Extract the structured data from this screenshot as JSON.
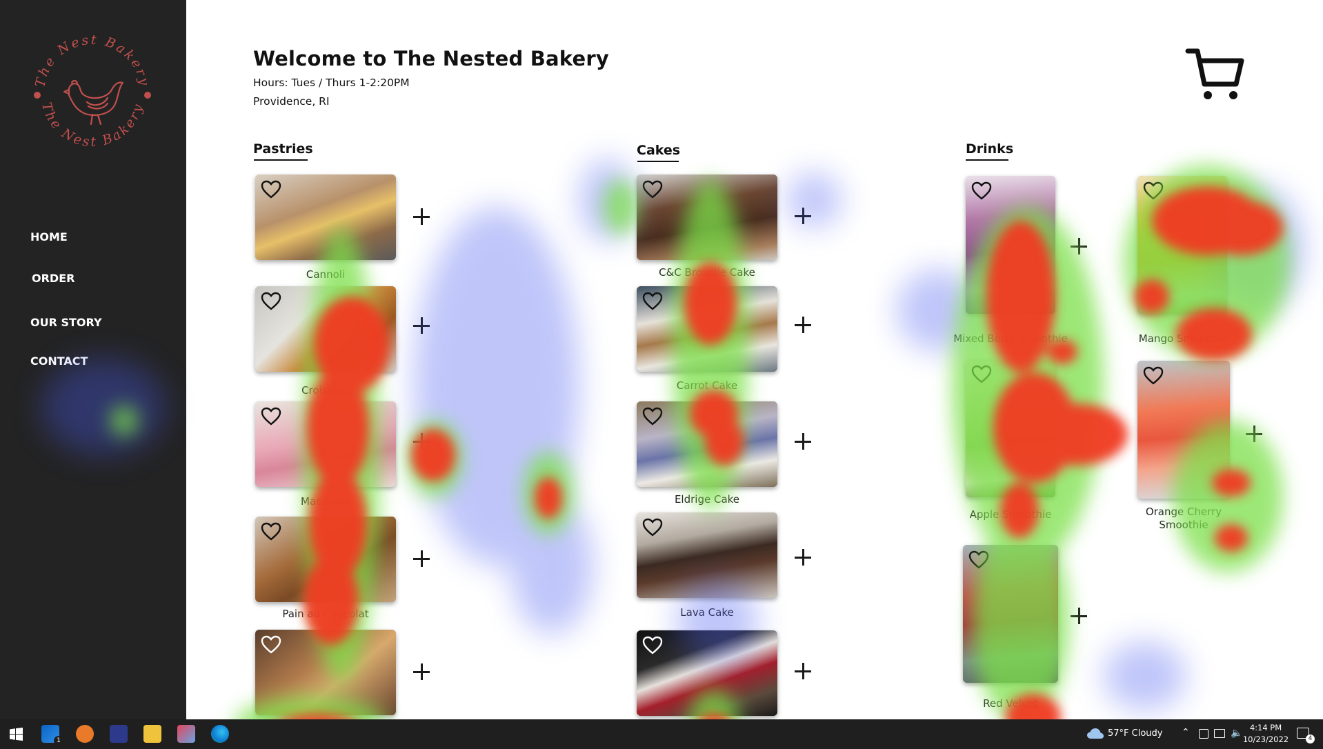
{
  "logo": {
    "text_top": "The Nest Bakery",
    "text_bottom": "The Nest Bakery",
    "color": "#c0504d"
  },
  "nav": [
    {
      "label": "HOME"
    },
    {
      "label": "ORDER"
    },
    {
      "label": "OUR STORY"
    },
    {
      "label": "CONTACT"
    }
  ],
  "header": {
    "title": "Welcome to The Nested Bakery",
    "hours": "Hours: Tues / Thurs 1-2:20PM",
    "location": "Providence, RI"
  },
  "icons": {
    "cart": "cart-icon",
    "favorite": "heart-icon",
    "add": "plus-icon"
  },
  "sections": [
    {
      "title": "Pastries",
      "items": [
        {
          "label": "Cannoli"
        },
        {
          "label": "Croissant"
        },
        {
          "label": "Macarons"
        },
        {
          "label": "Pain au Chocolat"
        },
        {
          "label": ""
        }
      ]
    },
    {
      "title": "Cakes",
      "items": [
        {
          "label": "C&C Brownie Cake"
        },
        {
          "label": "Carrot Cake"
        },
        {
          "label": "Eldrige Cake"
        },
        {
          "label": "Lava Cake"
        },
        {
          "label": ""
        }
      ]
    },
    {
      "title": "Drinks",
      "items": [
        {
          "label": "Mixed Berry Smoothie"
        },
        {
          "label": "Mango Smoothie"
        },
        {
          "label": "Apple Smoothie"
        },
        {
          "label": "Orange Cherry Smoothie"
        },
        {
          "label": "Red Velvet"
        }
      ]
    }
  ],
  "taskbar": {
    "weather": "57°F  Cloudy",
    "time": "4:14 PM",
    "date": "10/23/2022",
    "notification_count": "4",
    "mail_badge": "1"
  },
  "colors": {
    "sidebar": "#232323",
    "accent": "#c0504d",
    "taskbar": "#1f1f1f"
  }
}
